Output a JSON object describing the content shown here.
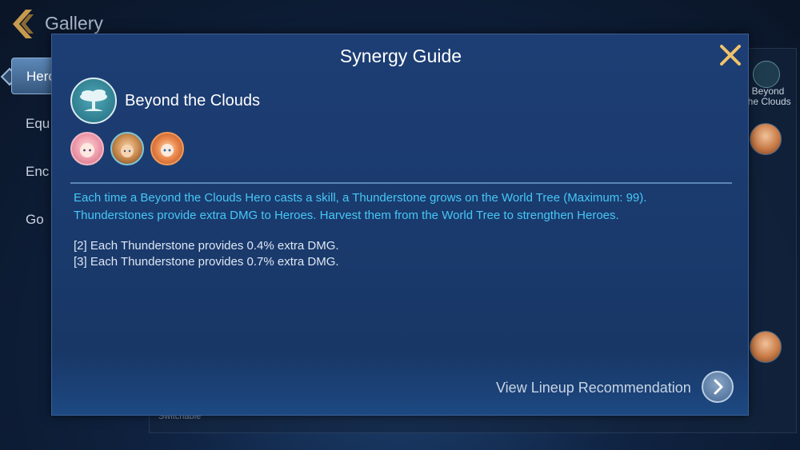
{
  "background": {
    "gallery_title": "Gallery",
    "side_tabs": [
      "Hero",
      "Equ",
      "Enc",
      "Go"
    ],
    "right_column_synergy_label": "Beyond the Clouds",
    "switch_label": "Switchable"
  },
  "modal": {
    "title": "Synergy Guide",
    "synergy": {
      "name": "Beyond the Clouds",
      "icon": "tree-icon",
      "heroes": [
        "hero-portrait-pink-hair",
        "hero-portrait-brown-hair",
        "hero-portrait-orange-hair"
      ]
    },
    "description": "Each time a Beyond the Clouds Hero casts a skill, a Thunderstone grows on the World Tree (Maximum: 99). Thunderstones provide extra DMG to Heroes. Harvest them from the World Tree to strengthen Heroes.",
    "tiers": [
      "[2] Each Thunderstone provides 0.4% extra DMG.",
      "[3] Each Thunderstone provides 0.7% extra DMG."
    ],
    "lineup_link_label": "View Lineup Recommendation"
  },
  "colors": {
    "description_text": "#46c7f5",
    "close_icon": "#f0c36a",
    "modal_bg": "#1d3e74"
  }
}
